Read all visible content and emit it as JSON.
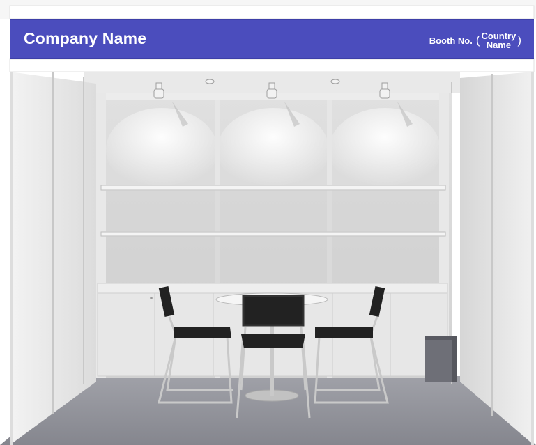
{
  "fascia": {
    "company_name": "Company Name",
    "booth_label": "Booth No.",
    "paren_open": "(",
    "paren_close": ")",
    "country_line1": "Country",
    "country_line2": "Name"
  },
  "colors": {
    "fascia_bg": "#4b4dbd",
    "wall": "#efefef",
    "carpet": "#8f9098",
    "chair_seat": "#222222",
    "chair_frame": "#c9c9c9"
  },
  "scene": {
    "spotlights": 3,
    "shelf_columns": 3,
    "chairs": 3,
    "objects": [
      "table",
      "waste-bin"
    ]
  }
}
